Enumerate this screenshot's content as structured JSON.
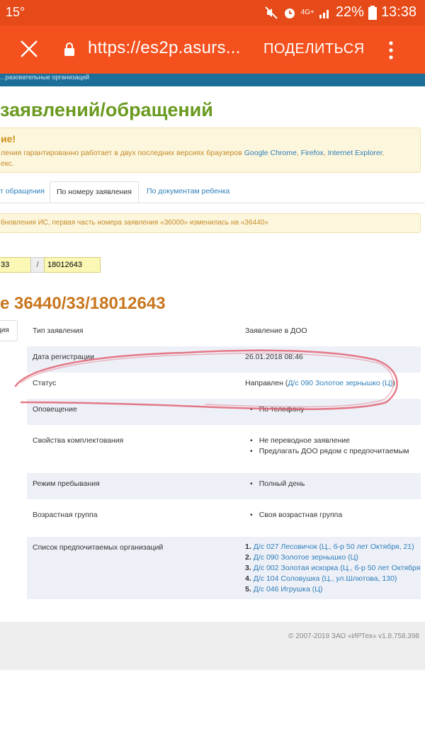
{
  "status_bar": {
    "temperature": "15°",
    "network": "4G+",
    "battery": "22%",
    "time": "13:38"
  },
  "browser": {
    "url": "https://es2p.asurs...",
    "share_label": "ПОДЕЛИТЬСЯ"
  },
  "page": {
    "band_text": "...разовательные организаций",
    "title": "заявлений/обращений",
    "notice": {
      "heading": "ие!",
      "text_before": "ления гарантированно работает в двух последних версиях браузеров ",
      "browsers": [
        "Google Chrome",
        "Firefox",
        "Internet Explorer"
      ],
      "text_end": "екс."
    },
    "tabs": [
      {
        "label": "т обращения"
      },
      {
        "label": "По номеру заявления"
      },
      {
        "label": "По документам ребенка"
      }
    ],
    "info_text": "бновления ИС, первая часть номера заявления «36000» изменилась на «36440»",
    "search": {
      "part1": "33",
      "separator": "/",
      "part2": "18012643"
    },
    "subtitle": "е 36440/33/18012643",
    "side_tab": "ция"
  },
  "details": {
    "type_label": "Тип заявления",
    "type_value": "Заявление в ДОО",
    "reg_date_label": "Дата регистрации",
    "reg_date_value": "26.01.2018 08:46",
    "status_label": "Статус",
    "status_prefix": "Направлен (",
    "status_link": "Д/с 090 Золотое зернышко (Ц)",
    "status_suffix": ")",
    "notify_label": "Оповещение",
    "notify_items": [
      "По телефону"
    ],
    "props_label": "Свойства комплектования",
    "props_items": [
      "Не переводное заявление",
      "Предлагать ДОО рядом с предпочитаемым"
    ],
    "mode_label": "Режим пребывания",
    "mode_items": [
      "Полный день"
    ],
    "age_label": "Возрастная группа",
    "age_items": [
      "Своя возрастная группа"
    ],
    "orgs_label": "Список предпочитаемых организаций",
    "orgs": [
      {
        "num": "1.",
        "name": "Д/с 027 Лесовичок (Ц., б-р 50 лет Октября, 21)"
      },
      {
        "num": "2.",
        "name": "Д/с 090 Золотое зернышко (Ц)"
      },
      {
        "num": "3.",
        "name": "Д/с 002 Золотая искорка (Ц., б-р 50 лет Октября"
      },
      {
        "num": "4.",
        "name": "Д/с 104 Соловушка (Ц., ул.Шлютова, 130)"
      },
      {
        "num": "5.",
        "name": "Д/с 046 Игрушка (Ц)"
      }
    ]
  },
  "footer": {
    "copyright": "© 2007-2019 ЗАО «ИРТех» v1.8.758.398"
  },
  "colors": {
    "status_bar": "#e64a19",
    "app_bar": "#f4511e",
    "band": "#1d6f9a",
    "title_green": "#6a9a1f",
    "subtitle_orange": "#c8761d",
    "link_blue": "#2f7fb8",
    "scribble": "#e05a6a"
  }
}
